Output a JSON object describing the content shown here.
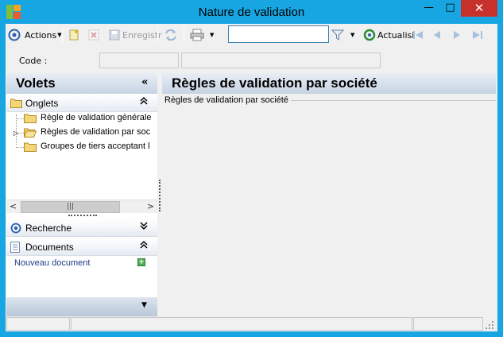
{
  "window": {
    "title": "Nature de validation",
    "minimize": "—",
    "maximize": "□",
    "close": "✕"
  },
  "toolbar": {
    "actions_label": "Actions",
    "save_label": "Enregistr",
    "refresh_label": "Actualisi",
    "search_value": ""
  },
  "code": {
    "label": "Code :",
    "value": "",
    "description": ""
  },
  "left_pane": {
    "title": "Volets",
    "collapse": "«",
    "sections": {
      "onglets": {
        "label": "Onglets",
        "chevron": "⌃"
      },
      "recherche": {
        "label": "Recherche",
        "chevron": "⌄"
      },
      "documents": {
        "label": "Documents",
        "chevron": "⌃"
      }
    },
    "tree_items": [
      {
        "label": "Règle de validation générale"
      },
      {
        "label": "Règles de validation par soc"
      },
      {
        "label": "Groupes de tiers acceptant l"
      }
    ],
    "new_document_link": "Nouveau document"
  },
  "right_pane": {
    "title": "Règles de validation par société",
    "group_label": "Règles de validation par société"
  },
  "colors": {
    "titlebar": "#18a6e3",
    "close_button": "#c7312b",
    "header_gradient_top": "#e9eef5",
    "header_gradient_bottom": "#c6d3e2",
    "link": "#1f3c8a"
  }
}
